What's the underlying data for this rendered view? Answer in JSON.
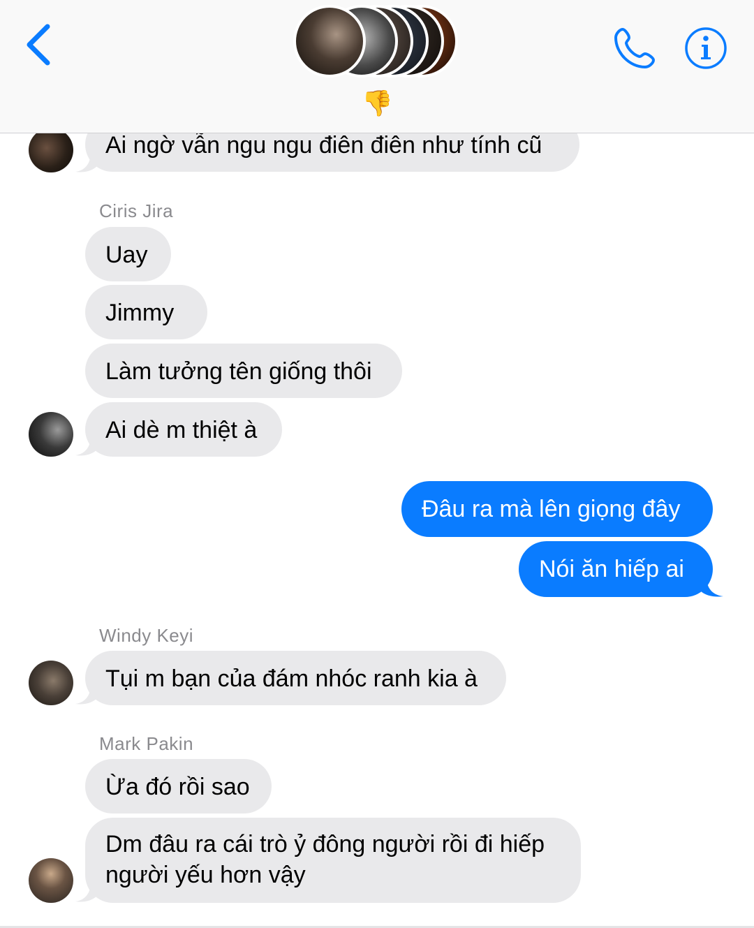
{
  "header": {
    "group_reaction": "👎",
    "back_icon": "chevron-left-icon",
    "call_icon": "phone-icon",
    "info_icon": "info-circle-icon",
    "accent": "#0a7cff"
  },
  "messages": [
    {
      "text": "Ai ngờ vẫn ngu ngu điên điên như tính cũ"
    },
    {
      "sender": "Ciris Jira"
    },
    {
      "text": "Uay"
    },
    {
      "text": "Jimmy"
    },
    {
      "text": "Làm tưởng tên giống thôi"
    },
    {
      "text": "Ai dè m thiệt à"
    },
    {
      "text": "Đâu ra mà lên giọng đây"
    },
    {
      "text": "Nói ăn hiếp ai"
    },
    {
      "sender": "Windy Keyi"
    },
    {
      "text": "Tụi m bạn của đám nhóc ranh kia à"
    },
    {
      "sender": "Mark Pakin"
    },
    {
      "text": "Ừa đó rồi sao"
    },
    {
      "text_line1": "Dm đâu ra cái trò ỷ đông người rồi đi hiếp",
      "text_line2": "người yếu hơn vậy"
    }
  ],
  "colors": {
    "incoming_bubble": "#e9e9eb",
    "outgoing_bubble": "#0a7cff",
    "sender_name": "#8a8a8e"
  }
}
